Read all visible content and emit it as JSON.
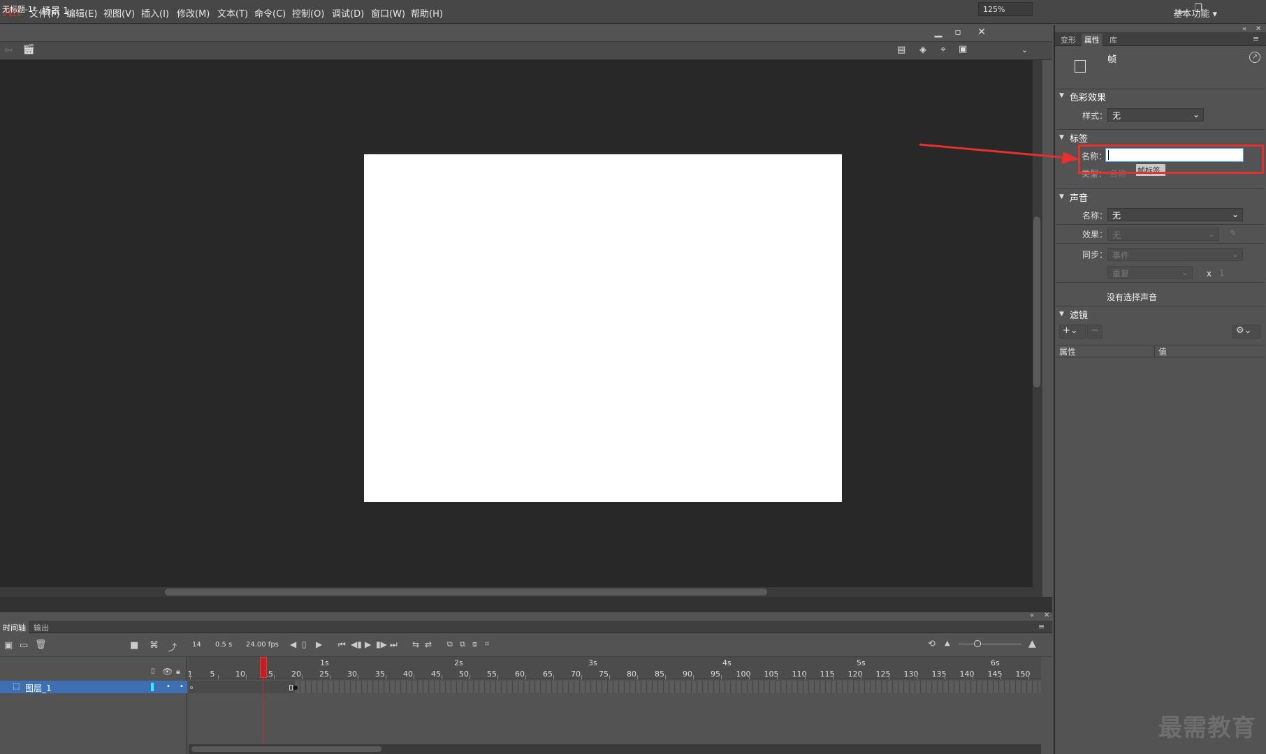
{
  "menubar": {
    "logo": "An",
    "items": [
      "文件(F)",
      "编辑(E)",
      "视图(V)",
      "插入(I)",
      "修改(M)",
      "文本(T)",
      "命令(C)",
      "控制(O)",
      "调试(D)",
      "窗口(W)",
      "帮助(H)"
    ],
    "workspace": "基本功能"
  },
  "document": {
    "title": "无标题-1*",
    "scene": "场景 1",
    "zoom": "125%"
  },
  "timeline": {
    "tabs": [
      "时间轴",
      "输出"
    ],
    "current_frame": "14",
    "elapsed": "0.5 s",
    "fps": "24.00 fps",
    "layer_name": "图层_1",
    "ruler_numbers": [
      "1",
      "5",
      "10",
      "15",
      "20",
      "25",
      "30",
      "35",
      "40",
      "45",
      "50",
      "55",
      "60",
      "65",
      "70",
      "75",
      "80",
      "85",
      "90",
      "95",
      "100",
      "105",
      "110",
      "115",
      "120",
      "125",
      "130",
      "135",
      "140",
      "145",
      "150"
    ],
    "ruler_seconds": [
      "1s",
      "2s",
      "3s",
      "4s",
      "5s",
      "6s"
    ]
  },
  "properties": {
    "tabs": [
      "变形",
      "属性",
      "库"
    ],
    "object_type": "帧",
    "color_effect": {
      "header": "色彩效果",
      "style_label": "样式：",
      "style_value": "无"
    },
    "label": {
      "header": "标签",
      "name_label": "名称：",
      "name_value": "",
      "type_label": "类型：",
      "type_value": "名称",
      "tag_text": "帧标签"
    },
    "sound": {
      "header": "声音",
      "name_label": "名称：",
      "name_value": "无",
      "effect_label": "效果：",
      "effect_value": "无",
      "sync_label": "同步：",
      "sync_value": "事件",
      "repeat_value": "重复",
      "repeat_x": "x",
      "repeat_count": "1",
      "no_sound": "没有选择声音"
    },
    "filters": {
      "header": "滤镜",
      "col_property": "属性",
      "col_value": "值"
    }
  },
  "watermark": "最需教育",
  "colors": {
    "annotation": "#e53030",
    "stage": "#ffffff",
    "pasteboard": "#282828",
    "layer_highlight": "#3e6fb3"
  }
}
